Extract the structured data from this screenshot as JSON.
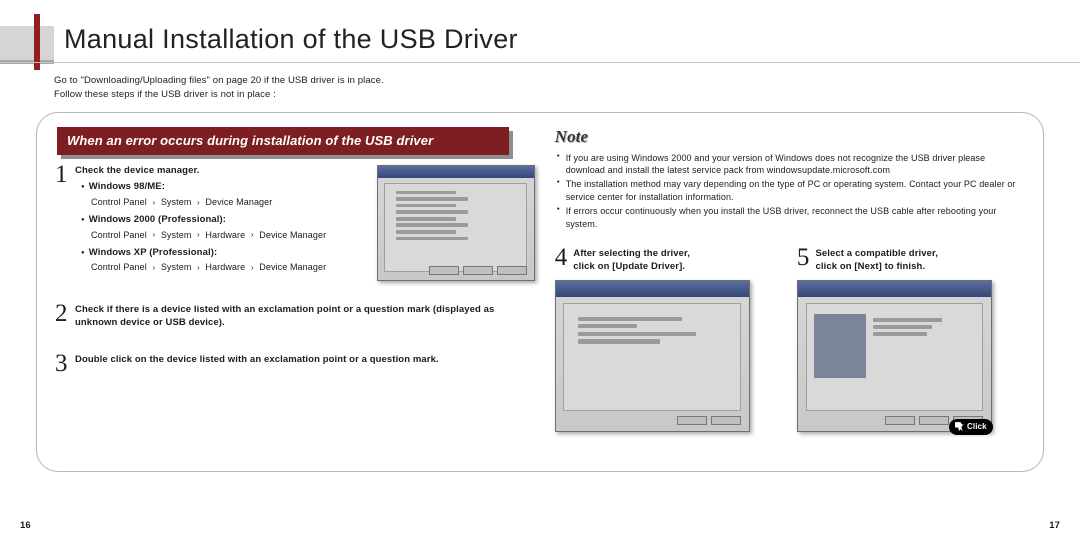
{
  "title": "Manual Installation of the USB Driver",
  "intro_line1": "Go to \"Downloading/Uploading files\" on page 20 if the USB driver is in place.",
  "intro_line2": "Follow these steps if the USB driver is not in place :",
  "banner": "When an error occurs during installation of the USB driver",
  "step1": {
    "num": "1",
    "title": "Check the device manager.",
    "os1": {
      "name": "Windows 98/ME:",
      "path_a": "Control Panel",
      "path_b": "System",
      "path_c": "Device Manager"
    },
    "os2": {
      "name": "Windows 2000 (Professional):",
      "path_a": "Control Panel",
      "path_b": "System",
      "path_c": "Hardware",
      "path_d": "Device Manager"
    },
    "os3": {
      "name": "Windows XP (Professional):",
      "path_a": "Control Panel",
      "path_b": "System",
      "path_c": "Hardware",
      "path_d": "Device Manager"
    }
  },
  "step2": {
    "num": "2",
    "text": "Check if there is a device listed with an exclamation point or a question mark (displayed as unknown device or USB device)."
  },
  "step3": {
    "num": "3",
    "text": "Double click on the device listed with an exclamation point or a question mark."
  },
  "note_title": "Note",
  "notes": [
    "If you are using Windows 2000 and your version of Windows does not recognize the USB driver please download and install the latest service pack from windowsupdate.microsoft.com",
    "The installation method may vary depending on the type of PC or operating system. Contact your PC dealer or service center for installation information.",
    "If errors occur continuously when you install the USB driver, reconnect the USB cable after rebooting your system."
  ],
  "step4": {
    "num": "4",
    "line1": "After selecting the driver,",
    "line2": "click on [Update Driver]."
  },
  "step5": {
    "num": "5",
    "line1": "Select a compatible driver,",
    "line2": "click on [Next] to finish."
  },
  "click_label": "Click",
  "page_left": "16",
  "page_right": "17",
  "arrow": "›"
}
